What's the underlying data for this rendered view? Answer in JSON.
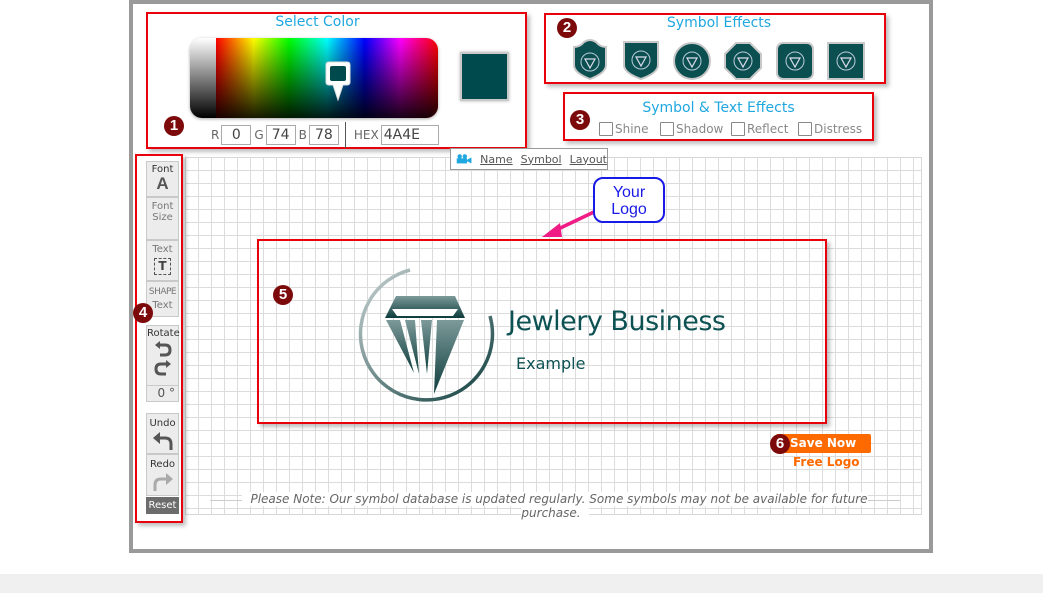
{
  "color_picker": {
    "title": "Select Color",
    "badge": "1",
    "r_label": "R",
    "r_value": "0",
    "g_label": "G",
    "g_value": "74",
    "b_label": "B",
    "b_value": "78",
    "hex_label": "HEX",
    "hex_value": "4A4E",
    "selected_color": "#004a4e"
  },
  "symbol_effects": {
    "title": "Symbol Effects",
    "badge": "2",
    "options": [
      "shield-notched",
      "shield",
      "circle",
      "octagon",
      "rounded-square",
      "square"
    ]
  },
  "text_effects": {
    "title": "Symbol & Text Effects",
    "badge": "3",
    "checkboxes": [
      {
        "label": "Shine",
        "checked": false
      },
      {
        "label": "Shadow",
        "checked": false
      },
      {
        "label": "Reflect",
        "checked": false
      },
      {
        "label": "Distress",
        "checked": false
      }
    ]
  },
  "top_tabs": {
    "icon": "video-camera-icon",
    "links": [
      "Name",
      "Symbol",
      "Layout"
    ]
  },
  "toolbar": {
    "badge": "4",
    "font": "Font",
    "font_size": [
      "Font",
      "Size"
    ],
    "text": "Text",
    "shape_text": [
      "SHAPE",
      "Text"
    ],
    "rotate": "Rotate",
    "rotate_value": "0 °",
    "undo": "Undo",
    "redo": "Redo",
    "reset": "Reset"
  },
  "logo": {
    "badge": "5",
    "callout": [
      "Your",
      "Logo"
    ],
    "title": "Jewlery Business",
    "subtitle": "Example",
    "brand_color": "#0d5153"
  },
  "save": {
    "badge": "6",
    "button": "Save Now",
    "sub": "Free Logo",
    "color": "#ff6a00"
  },
  "note": "Please Note: Our symbol database is updated regularly. Some symbols may not be available for future purchase."
}
